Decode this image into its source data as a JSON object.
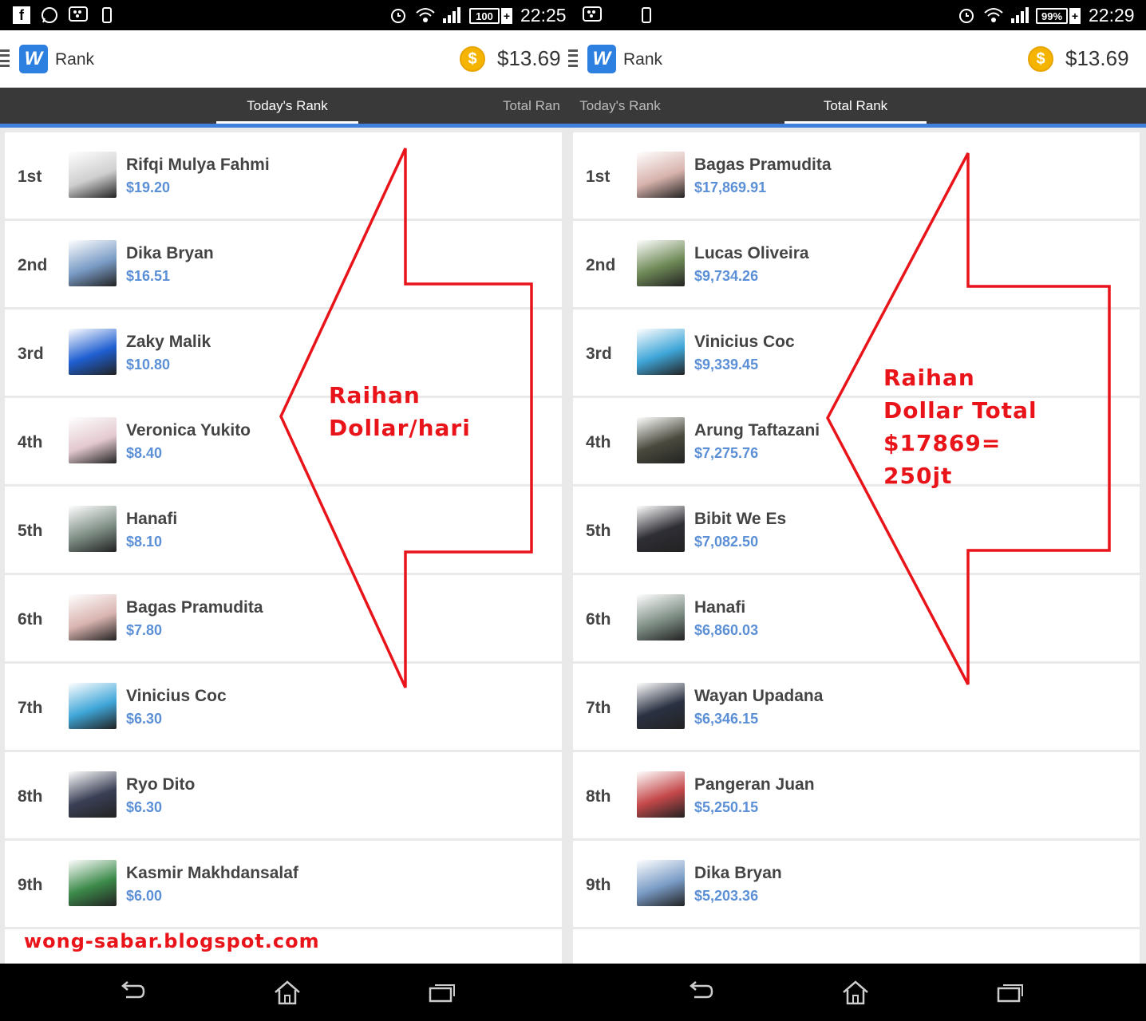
{
  "left": {
    "status": {
      "battery": "100",
      "time": "22:25"
    },
    "appbar": {
      "title": "Rank",
      "balance": "$13.69"
    },
    "tabs": {
      "today": "Today's Rank",
      "total": "Total Ran"
    },
    "rows": [
      {
        "rank": "1st",
        "name": "Rifqi Mulya Fahmi",
        "amount": "$19.20",
        "color": "#cfcfcf"
      },
      {
        "rank": "2nd",
        "name": "Dika Bryan",
        "amount": "$16.51",
        "color": "#7a9cc6"
      },
      {
        "rank": "3rd",
        "name": "Zaky Malik",
        "amount": "$10.80",
        "color": "#1f5fd1"
      },
      {
        "rank": "4th",
        "name": "Veronica Yukito",
        "amount": "$8.40",
        "color": "#e3c9cf"
      },
      {
        "rank": "5th",
        "name": "Hanafi",
        "amount": "$8.10",
        "color": "#7f8f86"
      },
      {
        "rank": "6th",
        "name": "Bagas Pramudita",
        "amount": "$7.80",
        "color": "#d9b4b0"
      },
      {
        "rank": "7th",
        "name": "Vinicius Coc",
        "amount": "$6.30",
        "color": "#3fa6d8"
      },
      {
        "rank": "8th",
        "name": "Ryo Dito",
        "amount": "$6.30",
        "color": "#3a3f55"
      },
      {
        "rank": "9th",
        "name": "Kasmir Makhdansalaf",
        "amount": "$6.00",
        "color": "#3c8a4a"
      }
    ]
  },
  "right": {
    "status": {
      "battery": "99%",
      "time": "22:29"
    },
    "appbar": {
      "title": "Rank",
      "balance": "$13.69"
    },
    "tabs": {
      "today": "Today's Rank",
      "total": "Total Rank"
    },
    "rows": [
      {
        "rank": "1st",
        "name": "Bagas Pramudita",
        "amount": "$17,869.91",
        "color": "#d8b3ad"
      },
      {
        "rank": "2nd",
        "name": "Lucas Oliveira",
        "amount": "$9,734.26",
        "color": "#6f8a57"
      },
      {
        "rank": "3rd",
        "name": "Vinicius Coc",
        "amount": "$9,339.45",
        "color": "#3fa6d8"
      },
      {
        "rank": "4th",
        "name": "Arung Taftazani",
        "amount": "$7,275.76",
        "color": "#4a4a3e"
      },
      {
        "rank": "5th",
        "name": "Bibit We Es",
        "amount": "$7,082.50",
        "color": "#2e2e35"
      },
      {
        "rank": "6th",
        "name": "Hanafi",
        "amount": "$6,860.03",
        "color": "#7f8f86"
      },
      {
        "rank": "7th",
        "name": "Wayan Upadana",
        "amount": "$6,346.15",
        "color": "#2a3142"
      },
      {
        "rank": "8th",
        "name": "Pangeran Juan",
        "amount": "$5,250.15",
        "color": "#c4484a"
      },
      {
        "rank": "9th",
        "name": "Dika Bryan",
        "amount": "$5,203.36",
        "color": "#7a9cc6"
      }
    ]
  },
  "annotations": {
    "left_line1": "Raihan",
    "left_line2": "Dollar/hari",
    "right_line1": "Raihan",
    "right_line2": "Dollar Total",
    "right_line3": "$17869=",
    "right_line4": "250jt",
    "color": "#e8141a"
  },
  "watermark": "wong-sabar.blogspot.com",
  "colors": {
    "accent": "#3f80dd",
    "tab_bg": "#393939",
    "amount": "#5b8fd6",
    "coin": "#f5b400"
  }
}
